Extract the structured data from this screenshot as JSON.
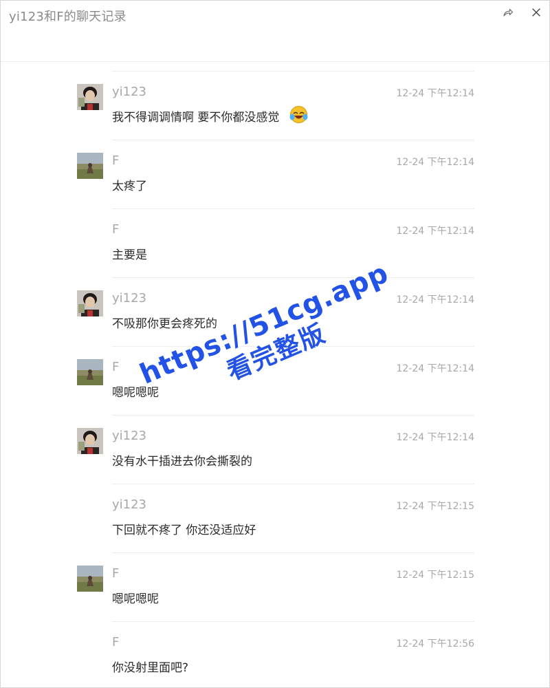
{
  "window": {
    "title": "yi123和F的聊天记录",
    "share_icon": "share-icon",
    "close_icon": "close-icon"
  },
  "messages": [
    {
      "sender": "yi123",
      "time": "12-24 下午12:14",
      "text": "我不得调调情啊 要不你都没感觉",
      "avatar": "person"
    },
    {
      "sender": "F",
      "time": "12-24 下午12:14",
      "text": "太疼了",
      "avatar": "landscape"
    },
    {
      "sender": "F",
      "time": "12-24 下午12:14",
      "text": "主要是",
      "avatar": "none"
    },
    {
      "sender": "yi123",
      "time": "12-24 下午12:14",
      "text": "不吸那你更会疼死的",
      "avatar": "person"
    },
    {
      "sender": "F",
      "time": "12-24 下午12:14",
      "text": "嗯呢嗯呢",
      "avatar": "landscape"
    },
    {
      "sender": "yi123",
      "time": "12-24 下午12:14",
      "text": "没有水干插进去你会撕裂的",
      "avatar": "person"
    },
    {
      "sender": "yi123",
      "time": "12-24 下午12:15",
      "text": "下回就不疼了 你还没适应好",
      "avatar": "none"
    },
    {
      "sender": "F",
      "time": "12-24 下午12:15",
      "text": "嗯呢嗯呢",
      "avatar": "landscape"
    },
    {
      "sender": "F",
      "time": "12-24 下午12:56",
      "text": "你没射里面吧?",
      "avatar": "none"
    }
  ],
  "watermark": {
    "line1": "https://51cg.app",
    "line2": "看完整版",
    "color": "#2352e6"
  },
  "colors": {
    "meta_text": "#a8a8a8",
    "message_text": "#2b2b2b",
    "separator": "#ececec"
  }
}
